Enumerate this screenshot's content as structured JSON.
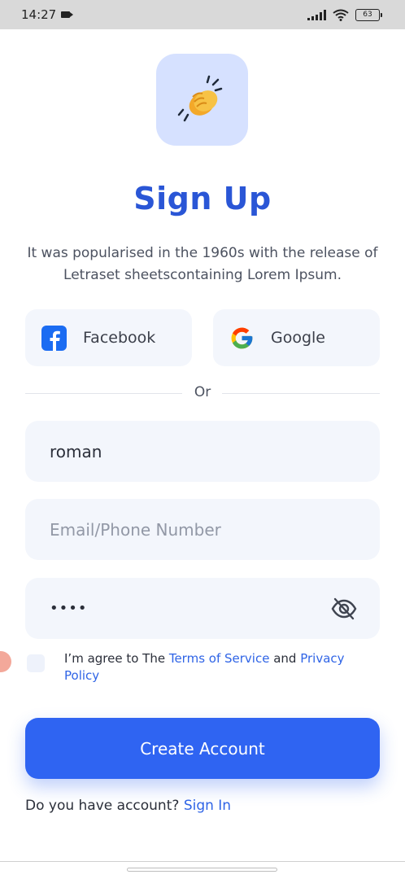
{
  "status_bar": {
    "time": "14:27",
    "battery": "63"
  },
  "logo": {
    "icon": "clapping-hands-icon"
  },
  "header": {
    "title": "Sign Up",
    "subtitle": "It was popularised in the 1960s with the release of Letraset sheetscontaining Lorem Ipsum."
  },
  "social": {
    "facebook_label": "Facebook",
    "google_label": "Google"
  },
  "divider": {
    "label": "Or"
  },
  "form": {
    "name_value": "roman",
    "email_placeholder": "Email/Phone Number",
    "password_value": "••••"
  },
  "terms": {
    "prefix": "I’m agree to The ",
    "terms_link": "Terms of Service",
    "middle": " and ",
    "privacy_link": "Privacy Policy"
  },
  "actions": {
    "create_account": "Create Account"
  },
  "footer": {
    "question": "Do you have account? ",
    "sign_in": "Sign In"
  },
  "colors": {
    "primary": "#2f64f2",
    "title": "#2a56d6",
    "field_bg": "#f3f6fc",
    "logo_bg": "#d6e1ff"
  }
}
